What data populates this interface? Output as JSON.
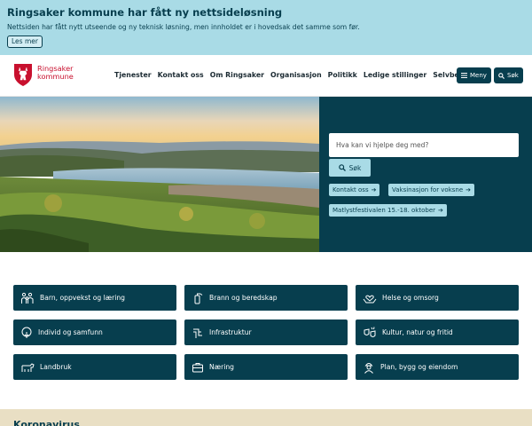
{
  "banner": {
    "title": "Ringsaker kommune har fått ny nettsideløsning",
    "text": "Nettsiden har fått nytt utseende og ny teknisk løsning, men innholdet er i hovedsak det samme som før.",
    "button": "Les mer"
  },
  "logo": {
    "line1": "Ringsaker",
    "line2": "kommune"
  },
  "nav": [
    "Tjenester",
    "Kontakt oss",
    "Om Ringsaker",
    "Organisasjon",
    "Politikk",
    "Ledige stillinger",
    "Selvbetjening"
  ],
  "header_buttons": {
    "menu": "Meny",
    "search": "Søk"
  },
  "search": {
    "placeholder": "Hva kan vi hjelpe deg med?",
    "button": "Søk"
  },
  "quick_links": [
    "Kontakt oss",
    "Vaksinasjon for voksne",
    "Matlystfestivalen 15.-18. oktober"
  ],
  "tiles": [
    {
      "label": "Barn, oppvekst og læring",
      "icon": "family-icon"
    },
    {
      "label": "Brann og beredskap",
      "icon": "fire-extinguisher-icon"
    },
    {
      "label": "Helse og omsorg",
      "icon": "heart-hands-icon"
    },
    {
      "label": "Individ og samfunn",
      "icon": "tree-icon"
    },
    {
      "label": "Infrastruktur",
      "icon": "pipes-icon"
    },
    {
      "label": "Kultur, natur og fritid",
      "icon": "theater-icon"
    },
    {
      "label": "Landbruk",
      "icon": "cow-icon"
    },
    {
      "label": "Næring",
      "icon": "briefcase-icon"
    },
    {
      "label": "Plan, bygg og eiendom",
      "icon": "worker-icon"
    }
  ],
  "bottom": {
    "title": "Koronavirus"
  },
  "colors": {
    "primary": "#073e4e",
    "accent": "#a9dbe6",
    "brand_red": "#c8102e"
  }
}
